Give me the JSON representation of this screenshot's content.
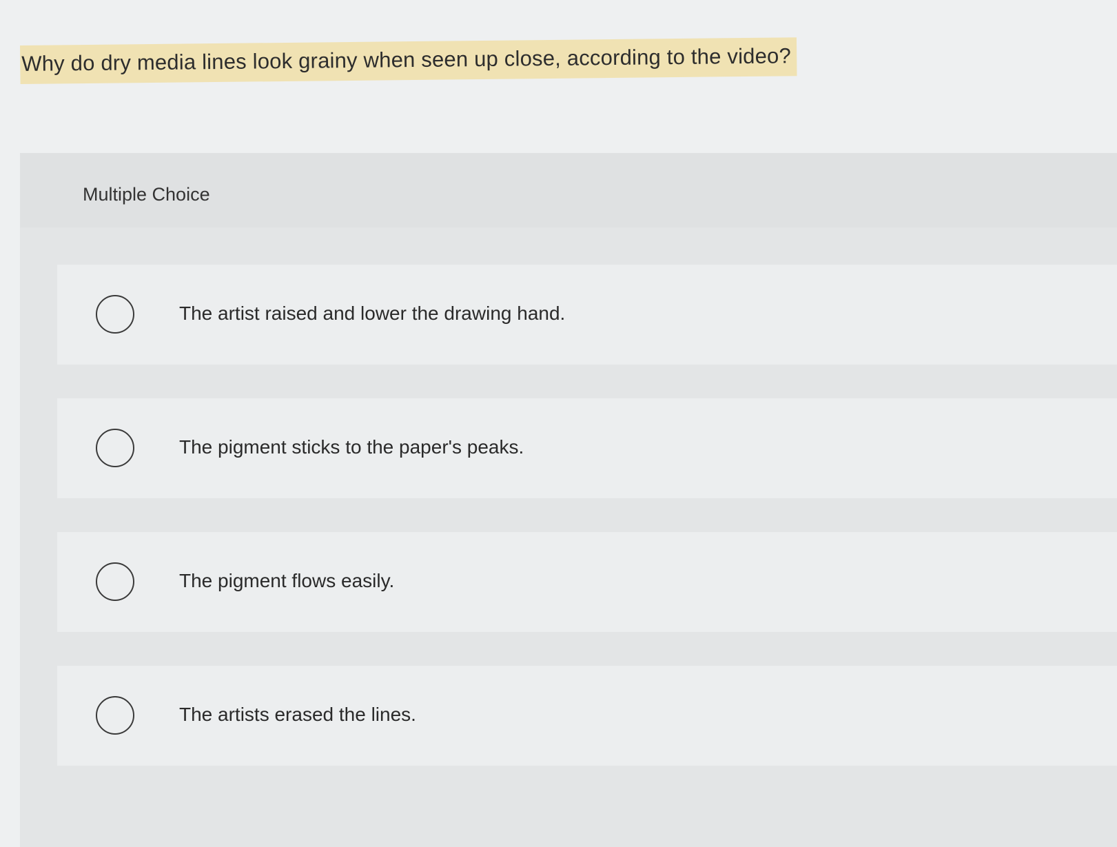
{
  "question": {
    "text": "Why do dry media lines look grainy when seen up close, according to the video?"
  },
  "panel": {
    "label": "Multiple Choice"
  },
  "options": [
    {
      "label": "The artist raised and lower the drawing hand.",
      "selected": false
    },
    {
      "label": "The pigment sticks to the paper's peaks.",
      "selected": false
    },
    {
      "label": "The pigment flows easily.",
      "selected": false
    },
    {
      "label": "The artists erased the lines.",
      "selected": false
    }
  ],
  "colors": {
    "highlight": "#f0e2b3",
    "background": "#eef0f1",
    "panel": "#e3e5e6",
    "option": "#eceeef"
  }
}
